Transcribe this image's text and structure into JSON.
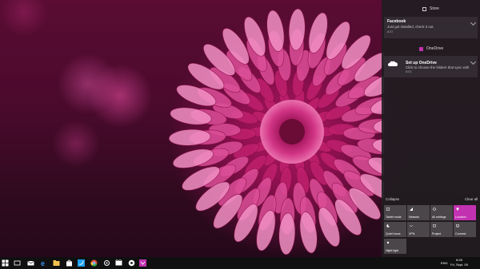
{
  "action_center": {
    "store": {
      "app_name": "Store",
      "title": "Facebook",
      "body": "Just got installed, check it out.",
      "time": "8:37"
    },
    "onedrive": {
      "app_name": "OneDrive",
      "title": "Set up OneDrive",
      "body": "Click to choose the folders that sync with",
      "time": "8:03"
    },
    "collapse_label": "Collapse",
    "clear_all_label": "Clear all",
    "tiles": [
      {
        "label": "Tablet mode",
        "icon": "tablet-mode-icon",
        "active": false
      },
      {
        "label": "Network",
        "icon": "network-icon",
        "active": false
      },
      {
        "label": "All settings",
        "icon": "gear-icon",
        "active": false
      },
      {
        "label": "Location",
        "icon": "location-icon",
        "active": true
      },
      {
        "label": "Quiet hours",
        "icon": "moon-icon",
        "active": false
      },
      {
        "label": "VPN",
        "icon": "vpn-icon",
        "active": false
      },
      {
        "label": "Project",
        "icon": "project-icon",
        "active": false
      },
      {
        "label": "Connect",
        "icon": "connect-icon",
        "active": false
      },
      {
        "label": "Night light",
        "icon": "brightness-icon",
        "active": false
      }
    ],
    "accent_color": "#c232b0"
  },
  "taskbar": {
    "icons": [
      "windows-start-icon",
      "task-view-icon",
      "mail-icon",
      "edge-icon",
      "file-explorer-icon",
      "store-icon",
      "twitter-icon",
      "chrome-icon",
      "settings-icon",
      "movies-icon",
      "media-icon",
      "photos-icon"
    ],
    "language": "ENG",
    "time": "8:28",
    "date": "Fri, Sept. 09"
  }
}
